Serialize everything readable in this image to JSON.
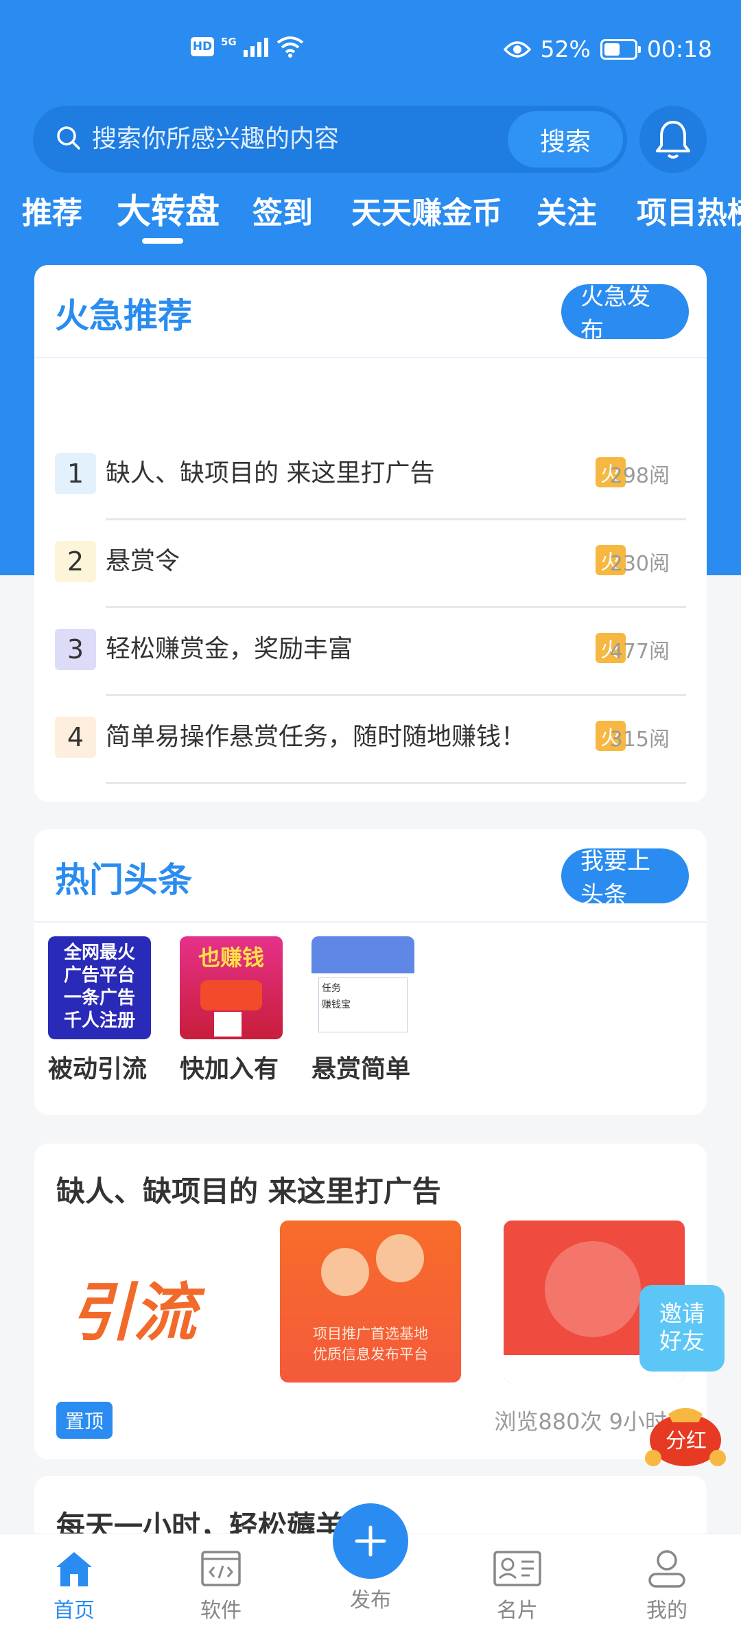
{
  "status_bar": {
    "network": "5G",
    "battery": "52%",
    "battery_level": 0.52,
    "time": "00:18"
  },
  "search": {
    "placeholder": "搜索你所感兴趣的内容",
    "button": "搜索"
  },
  "tabs": [
    {
      "label": "推荐"
    },
    {
      "label": "大转盘",
      "active": true
    },
    {
      "label": "签到"
    },
    {
      "label": "天天赚金币"
    },
    {
      "label": "关注"
    },
    {
      "label": "项目热榜"
    }
  ],
  "hot_recommend": {
    "title": "火急推荐",
    "publish_button": "火急发布",
    "fire_label": "火",
    "items": [
      {
        "rank": "1",
        "title": "缺人、缺项目的 来这里打广告",
        "reads": "298阅"
      },
      {
        "rank": "2",
        "title": "悬赏令",
        "reads": "230阅"
      },
      {
        "rank": "3",
        "title": "轻松赚赏金，奖励丰富",
        "reads": "477阅"
      },
      {
        "rank": "4",
        "title": "简单易操作悬赏任务，随时随地赚钱！",
        "reads": "315阅"
      }
    ]
  },
  "headlines": {
    "title": "热门头条",
    "button": "我要上头条",
    "items": [
      {
        "label": "被动引流",
        "thumb_lines": [
          "全网最火",
          "广告平台",
          "一条广告",
          "千人注册"
        ]
      },
      {
        "label": "快加入有",
        "thumb_text": "也赚钱"
      },
      {
        "label": "悬赏简单",
        "thumb_texts": [
          "任务",
          "赚钱宝"
        ]
      }
    ]
  },
  "post": {
    "title": "缺人、缺项目的 来这里打广告",
    "img1_text": "引流",
    "img2_lines": [
      "项目推广首选基地",
      "优质信息发布平台"
    ],
    "pin": "置顶",
    "meta": "浏览880次 9小时"
  },
  "next_post": {
    "title": "每天一小时，轻松薅羊"
  },
  "float": {
    "invite_line1": "邀请",
    "invite_line2": "好友",
    "dividend": "分红"
  },
  "bottom_nav": {
    "home": "首页",
    "software": "软件",
    "publish": "发布",
    "card": "名片",
    "mine": "我的"
  },
  "colors": {
    "primary": "#2a8cf0",
    "fire": "#f6b840"
  }
}
